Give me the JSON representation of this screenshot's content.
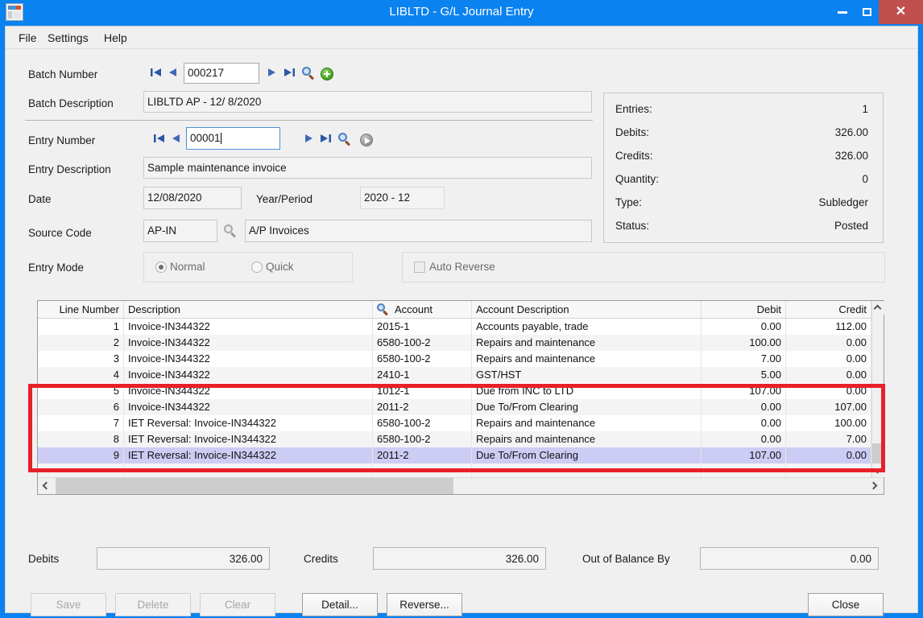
{
  "window": {
    "title": "LIBLTD - G/L Journal Entry",
    "icon": "window-app-icon",
    "minimize_label": "–",
    "maximize_label": "☐",
    "close_label": "✕"
  },
  "menubar": {
    "items": [
      {
        "label": "File"
      },
      {
        "label": "Settings"
      },
      {
        "label": "Help"
      }
    ]
  },
  "form": {
    "batch_number_label": "Batch Number",
    "batch_number_value": "000217",
    "batch_description_label": "Batch Description",
    "batch_description_value": "LIBLTD AP - 12/ 8/2020",
    "entry_number_label": "Entry Number",
    "entry_number_value": "00001",
    "entry_description_label": "Entry Description",
    "entry_description_value": "Sample maintenance invoice",
    "date_label": "Date",
    "date_value": "12/08/2020",
    "year_period_label": "Year/Period",
    "year_period_value": "2020 - 12",
    "source_code_label": "Source Code",
    "source_code_value": "AP-IN",
    "source_code_description": "A/P Invoices",
    "entry_mode_label": "Entry Mode",
    "mode_normal_label": "Normal",
    "mode_quick_label": "Quick",
    "mode_selected": "Normal",
    "auto_reverse_label": "Auto Reverse",
    "auto_reverse_checked": false
  },
  "summary": {
    "rows": [
      {
        "label": "Entries:",
        "value": "1"
      },
      {
        "label": "Debits:",
        "value": "326.00"
      },
      {
        "label": "Credits:",
        "value": "326.00"
      },
      {
        "label": "Quantity:",
        "value": "0"
      },
      {
        "label": "Type:",
        "value": "Subledger"
      },
      {
        "label": "Status:",
        "value": "Posted"
      }
    ]
  },
  "grid": {
    "columns": [
      {
        "key": "line",
        "label": "Line Number",
        "align": "right"
      },
      {
        "key": "desc",
        "label": "Description",
        "align": "left"
      },
      {
        "key": "account",
        "label": "Account",
        "align": "left",
        "icon": "magnifier-icon"
      },
      {
        "key": "acctdesc",
        "label": "Account Description",
        "align": "left"
      },
      {
        "key": "debit",
        "label": "Debit",
        "align": "right"
      },
      {
        "key": "credit",
        "label": "Credit",
        "align": "right"
      }
    ],
    "rows": [
      {
        "line": "1",
        "desc": "Invoice-IN344322",
        "account": "2015-1",
        "acctdesc": "Accounts payable, trade",
        "debit": "0.00",
        "credit": "112.00",
        "selected": false
      },
      {
        "line": "2",
        "desc": "Invoice-IN344322",
        "account": "6580-100-2",
        "acctdesc": "Repairs and maintenance",
        "debit": "100.00",
        "credit": "0.00",
        "selected": false
      },
      {
        "line": "3",
        "desc": "Invoice-IN344322",
        "account": "6580-100-2",
        "acctdesc": "Repairs and maintenance",
        "debit": "7.00",
        "credit": "0.00",
        "selected": false
      },
      {
        "line": "4",
        "desc": "Invoice-IN344322",
        "account": "2410-1",
        "acctdesc": "GST/HST",
        "debit": "5.00",
        "credit": "0.00",
        "selected": false
      },
      {
        "line": "5",
        "desc": "Invoice-IN344322",
        "account": "1012-1",
        "acctdesc": "Due from INC to LTD",
        "debit": "107.00",
        "credit": "0.00",
        "selected": false
      },
      {
        "line": "6",
        "desc": "Invoice-IN344322",
        "account": "2011-2",
        "acctdesc": "Due To/From Clearing",
        "debit": "0.00",
        "credit": "107.00",
        "selected": false
      },
      {
        "line": "7",
        "desc": "IET Reversal: Invoice-IN344322",
        "account": "6580-100-2",
        "acctdesc": "Repairs and maintenance",
        "debit": "0.00",
        "credit": "100.00",
        "selected": false
      },
      {
        "line": "8",
        "desc": "IET Reversal: Invoice-IN344322",
        "account": "6580-100-2",
        "acctdesc": "Repairs and maintenance",
        "debit": "0.00",
        "credit": "7.00",
        "selected": false
      },
      {
        "line": "9",
        "desc": "IET Reversal: Invoice-IN344322",
        "account": "2011-2",
        "acctdesc": "Due To/From Clearing",
        "debit": "107.00",
        "credit": "0.00",
        "selected": true
      }
    ]
  },
  "totals": {
    "debits_label": "Debits",
    "debits_value": "326.00",
    "credits_label": "Credits",
    "credits_value": "326.00",
    "out_of_balance_label": "Out of Balance By",
    "out_of_balance_value": "0.00"
  },
  "buttons": {
    "save": "Save",
    "delete": "Delete",
    "clear": "Clear",
    "detail": "Detail...",
    "reverse": "Reverse...",
    "close": "Close"
  },
  "annotation": {
    "highlight_color": "#e8202a",
    "selected_row_color": "#ccccf5"
  }
}
